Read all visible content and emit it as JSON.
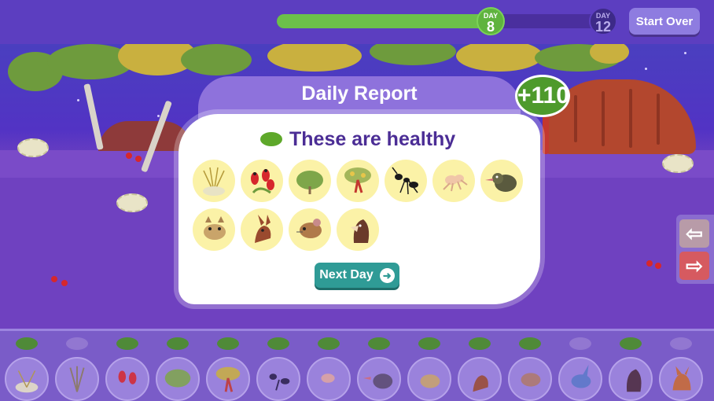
{
  "header": {
    "progress": {
      "current_day_label": "DAY",
      "current_day": "8",
      "total_day_label": "DAY",
      "total_day": "12",
      "fraction": 0.667
    },
    "start_over_label": "Start Over"
  },
  "dialog": {
    "title": "Daily Report",
    "score": "+110",
    "status_text": "These are healthy",
    "status_color": "#5ea82a",
    "next_day_label": "Next Day",
    "healthy_species_icons": [
      "grass-tussock-icon",
      "desert-pea-flower-icon",
      "saltbush-shrub-icon",
      "gum-tree-icon",
      "ant-icon",
      "spider-icon",
      "bird-icon",
      "marsupial-mouse-icon",
      "kangaroo-icon",
      "hopping-mouse-icon",
      "hawk-icon"
    ]
  },
  "tray": {
    "status_pills": [
      "green",
      "purple",
      "green",
      "green",
      "green",
      "green",
      "green",
      "green",
      "green",
      "green",
      "green",
      "purple",
      "green",
      "purple"
    ],
    "species_icons": [
      "grass-tussock-icon",
      "dry-shrub-icon",
      "desert-pea-flower-icon",
      "saltbush-shrub-icon",
      "gum-tree-icon",
      "ant-icon",
      "spider-icon",
      "bird-icon",
      "marsupial-mouse-icon",
      "kangaroo-icon",
      "hopping-mouse-icon",
      "bilby-icon",
      "hawk-icon",
      "dingo-icon"
    ]
  },
  "colors": {
    "background": "#6f41c0",
    "accent_green": "#6cc04a",
    "button_teal": "#2f9b96",
    "arrow_red": "#d65a60"
  }
}
